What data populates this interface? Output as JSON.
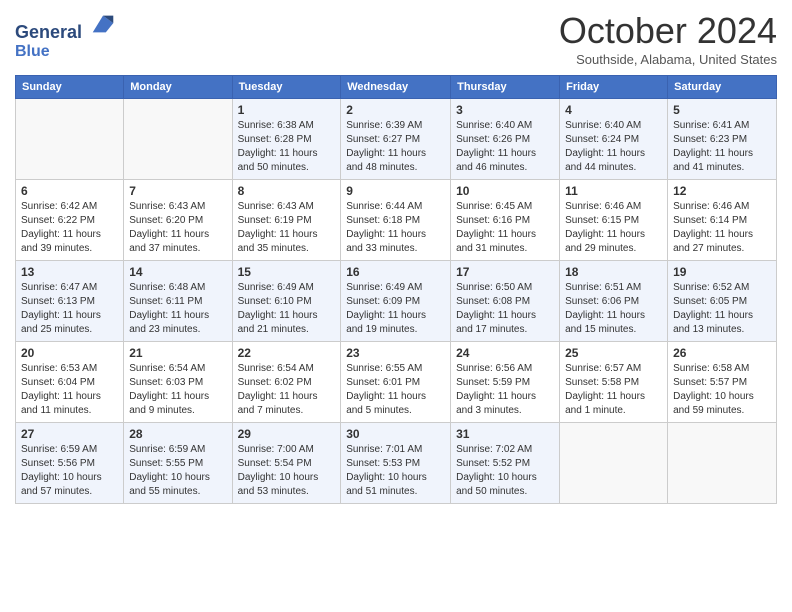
{
  "header": {
    "logo_line1": "General",
    "logo_line2": "Blue",
    "month": "October 2024",
    "location": "Southside, Alabama, United States"
  },
  "days_of_week": [
    "Sunday",
    "Monday",
    "Tuesday",
    "Wednesday",
    "Thursday",
    "Friday",
    "Saturday"
  ],
  "weeks": [
    [
      {
        "day": "",
        "sunrise": "",
        "sunset": "",
        "daylight": ""
      },
      {
        "day": "",
        "sunrise": "",
        "sunset": "",
        "daylight": ""
      },
      {
        "day": "1",
        "sunrise": "Sunrise: 6:38 AM",
        "sunset": "Sunset: 6:28 PM",
        "daylight": "Daylight: 11 hours and 50 minutes."
      },
      {
        "day": "2",
        "sunrise": "Sunrise: 6:39 AM",
        "sunset": "Sunset: 6:27 PM",
        "daylight": "Daylight: 11 hours and 48 minutes."
      },
      {
        "day": "3",
        "sunrise": "Sunrise: 6:40 AM",
        "sunset": "Sunset: 6:26 PM",
        "daylight": "Daylight: 11 hours and 46 minutes."
      },
      {
        "day": "4",
        "sunrise": "Sunrise: 6:40 AM",
        "sunset": "Sunset: 6:24 PM",
        "daylight": "Daylight: 11 hours and 44 minutes."
      },
      {
        "day": "5",
        "sunrise": "Sunrise: 6:41 AM",
        "sunset": "Sunset: 6:23 PM",
        "daylight": "Daylight: 11 hours and 41 minutes."
      }
    ],
    [
      {
        "day": "6",
        "sunrise": "Sunrise: 6:42 AM",
        "sunset": "Sunset: 6:22 PM",
        "daylight": "Daylight: 11 hours and 39 minutes."
      },
      {
        "day": "7",
        "sunrise": "Sunrise: 6:43 AM",
        "sunset": "Sunset: 6:20 PM",
        "daylight": "Daylight: 11 hours and 37 minutes."
      },
      {
        "day": "8",
        "sunrise": "Sunrise: 6:43 AM",
        "sunset": "Sunset: 6:19 PM",
        "daylight": "Daylight: 11 hours and 35 minutes."
      },
      {
        "day": "9",
        "sunrise": "Sunrise: 6:44 AM",
        "sunset": "Sunset: 6:18 PM",
        "daylight": "Daylight: 11 hours and 33 minutes."
      },
      {
        "day": "10",
        "sunrise": "Sunrise: 6:45 AM",
        "sunset": "Sunset: 6:16 PM",
        "daylight": "Daylight: 11 hours and 31 minutes."
      },
      {
        "day": "11",
        "sunrise": "Sunrise: 6:46 AM",
        "sunset": "Sunset: 6:15 PM",
        "daylight": "Daylight: 11 hours and 29 minutes."
      },
      {
        "day": "12",
        "sunrise": "Sunrise: 6:46 AM",
        "sunset": "Sunset: 6:14 PM",
        "daylight": "Daylight: 11 hours and 27 minutes."
      }
    ],
    [
      {
        "day": "13",
        "sunrise": "Sunrise: 6:47 AM",
        "sunset": "Sunset: 6:13 PM",
        "daylight": "Daylight: 11 hours and 25 minutes."
      },
      {
        "day": "14",
        "sunrise": "Sunrise: 6:48 AM",
        "sunset": "Sunset: 6:11 PM",
        "daylight": "Daylight: 11 hours and 23 minutes."
      },
      {
        "day": "15",
        "sunrise": "Sunrise: 6:49 AM",
        "sunset": "Sunset: 6:10 PM",
        "daylight": "Daylight: 11 hours and 21 minutes."
      },
      {
        "day": "16",
        "sunrise": "Sunrise: 6:49 AM",
        "sunset": "Sunset: 6:09 PM",
        "daylight": "Daylight: 11 hours and 19 minutes."
      },
      {
        "day": "17",
        "sunrise": "Sunrise: 6:50 AM",
        "sunset": "Sunset: 6:08 PM",
        "daylight": "Daylight: 11 hours and 17 minutes."
      },
      {
        "day": "18",
        "sunrise": "Sunrise: 6:51 AM",
        "sunset": "Sunset: 6:06 PM",
        "daylight": "Daylight: 11 hours and 15 minutes."
      },
      {
        "day": "19",
        "sunrise": "Sunrise: 6:52 AM",
        "sunset": "Sunset: 6:05 PM",
        "daylight": "Daylight: 11 hours and 13 minutes."
      }
    ],
    [
      {
        "day": "20",
        "sunrise": "Sunrise: 6:53 AM",
        "sunset": "Sunset: 6:04 PM",
        "daylight": "Daylight: 11 hours and 11 minutes."
      },
      {
        "day": "21",
        "sunrise": "Sunrise: 6:54 AM",
        "sunset": "Sunset: 6:03 PM",
        "daylight": "Daylight: 11 hours and 9 minutes."
      },
      {
        "day": "22",
        "sunrise": "Sunrise: 6:54 AM",
        "sunset": "Sunset: 6:02 PM",
        "daylight": "Daylight: 11 hours and 7 minutes."
      },
      {
        "day": "23",
        "sunrise": "Sunrise: 6:55 AM",
        "sunset": "Sunset: 6:01 PM",
        "daylight": "Daylight: 11 hours and 5 minutes."
      },
      {
        "day": "24",
        "sunrise": "Sunrise: 6:56 AM",
        "sunset": "Sunset: 5:59 PM",
        "daylight": "Daylight: 11 hours and 3 minutes."
      },
      {
        "day": "25",
        "sunrise": "Sunrise: 6:57 AM",
        "sunset": "Sunset: 5:58 PM",
        "daylight": "Daylight: 11 hours and 1 minute."
      },
      {
        "day": "26",
        "sunrise": "Sunrise: 6:58 AM",
        "sunset": "Sunset: 5:57 PM",
        "daylight": "Daylight: 10 hours and 59 minutes."
      }
    ],
    [
      {
        "day": "27",
        "sunrise": "Sunrise: 6:59 AM",
        "sunset": "Sunset: 5:56 PM",
        "daylight": "Daylight: 10 hours and 57 minutes."
      },
      {
        "day": "28",
        "sunrise": "Sunrise: 6:59 AM",
        "sunset": "Sunset: 5:55 PM",
        "daylight": "Daylight: 10 hours and 55 minutes."
      },
      {
        "day": "29",
        "sunrise": "Sunrise: 7:00 AM",
        "sunset": "Sunset: 5:54 PM",
        "daylight": "Daylight: 10 hours and 53 minutes."
      },
      {
        "day": "30",
        "sunrise": "Sunrise: 7:01 AM",
        "sunset": "Sunset: 5:53 PM",
        "daylight": "Daylight: 10 hours and 51 minutes."
      },
      {
        "day": "31",
        "sunrise": "Sunrise: 7:02 AM",
        "sunset": "Sunset: 5:52 PM",
        "daylight": "Daylight: 10 hours and 50 minutes."
      },
      {
        "day": "",
        "sunrise": "",
        "sunset": "",
        "daylight": ""
      },
      {
        "day": "",
        "sunrise": "",
        "sunset": "",
        "daylight": ""
      }
    ]
  ]
}
